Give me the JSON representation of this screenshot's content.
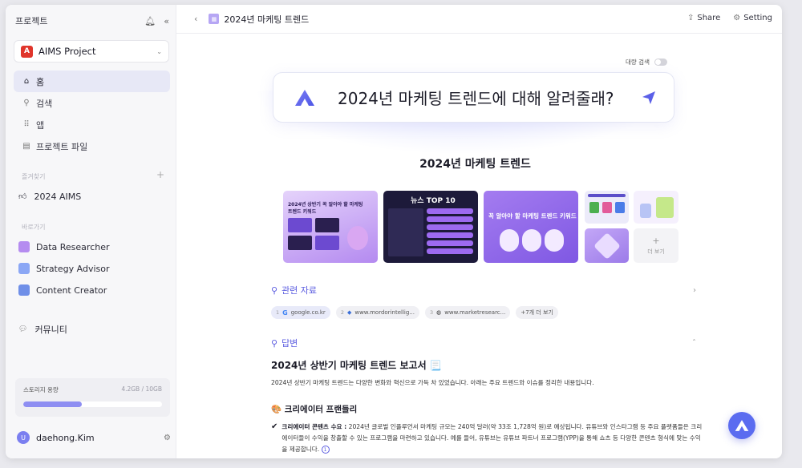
{
  "sidebar": {
    "title": "프로젝트",
    "project": {
      "logo": "A",
      "name": "AIMS Project"
    },
    "nav": [
      {
        "label": "홈",
        "icon": "home-icon"
      },
      {
        "label": "검색",
        "icon": "search-icon"
      },
      {
        "label": "앱",
        "icon": "apps-icon"
      },
      {
        "label": "프로젝트 파일",
        "icon": "file-icon"
      }
    ],
    "favorites_label": "즐겨찾기",
    "favorites": [
      {
        "label": "2024 AIMS"
      }
    ],
    "shortcuts_label": "바로가기",
    "agents": [
      {
        "label": "Data Researcher",
        "color": "#b58cf0"
      },
      {
        "label": "Strategy Advisor",
        "color": "#8ba7f5"
      },
      {
        "label": "Content Creator",
        "color": "#6f8fe8"
      }
    ],
    "community": "커뮤니티",
    "storage": {
      "label": "스토리지 용량",
      "amount": "4.2GB / 10GB",
      "fraction": 0.42
    },
    "user": {
      "initial": "U",
      "name": "daehong.Kim"
    }
  },
  "topbar": {
    "doc_title": "2024년 마케팅 트렌드",
    "share": "Share",
    "setting": "Setting"
  },
  "main": {
    "toggle_label": "대량 검색",
    "query": "2024년 마케팅 트렌드에 대해 알려줄래?",
    "heading": "2024년 마케팅 트렌드",
    "thumbs": [
      {
        "text": "2024년 상반기 꼭 알아야 할 마케팅 트렌드 키워드"
      },
      {
        "text": "뉴스 TOP 10"
      },
      {
        "text": "꼭 알아야 할 마케팅 트렌드 키워드"
      }
    ],
    "more_label": "더 보기",
    "related_label": "관련 자료",
    "chips": [
      {
        "n": "1",
        "text": "google.co.kr"
      },
      {
        "n": "2",
        "text": "www.mordorintellig..."
      },
      {
        "n": "3",
        "text": "www.marketresearc..."
      }
    ],
    "chips_more": "+7개 더 보기",
    "answer_label": "답변",
    "answer_title": "2024년 상반기 마케팅 트렌드 보고서 📃",
    "answer_intro": "2024년 상반기 마케팅 트렌드는 다양한 변화와 혁신으로 가득 차 있었습니다. 아래는 주요 트렌드와 이슈를 정리한 내용입니다.",
    "sub_title": "🎨 크리에이터 프랜들리",
    "bullet_bold": "크리에이터 콘텐츠 수요 :",
    "bullet_text": " 2024년 글로벌 인플루언서 마케팅 규모는 240억 달러(약 33조 1,728억 원)로 예상됩니다. 유튜브와 인스타그램 등 주요 플랫폼들은 크리에이터들이 수익을 창출할 수 있는 프로그램을 마련하고 있습니다. 예를 들어, 유튜브는 유튜브 파트너 프로그램(YPP)을 통해 쇼츠 등 다양한 콘텐츠 형식에 맞는 수익을 제공합니다.",
    "cite": "1"
  }
}
